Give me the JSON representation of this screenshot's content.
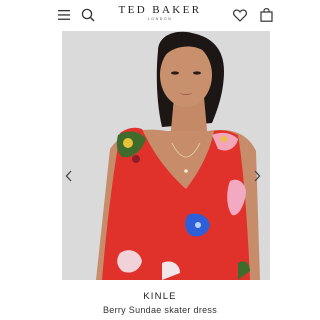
{
  "header": {
    "brand_name": "TED BAKER",
    "brand_sub": "LONDON",
    "icons": [
      "menu-icon",
      "search-icon",
      "heart-icon",
      "bag-icon"
    ]
  },
  "gallery": {
    "background": "#d9d9d9",
    "dress_color": "#e0322b",
    "prev_icon": "chevron-left-icon",
    "next_icon": "chevron-right-icon"
  },
  "product": {
    "title": "KINLE",
    "subtitle": "Berry Sundae skater dress"
  }
}
